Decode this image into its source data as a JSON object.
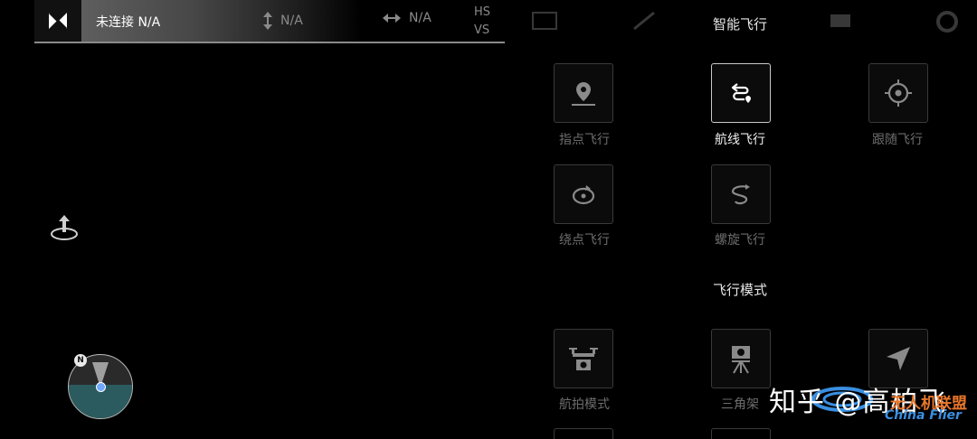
{
  "status_bar": {
    "connection": "未连接 N/A",
    "altitude": "N/A",
    "distance": "N/A",
    "hs": "HS",
    "vs": "VS"
  },
  "compass": {
    "north": "N"
  },
  "smart_flight": {
    "title": "智能飞行",
    "items": [
      {
        "label": "指点飞行",
        "icon": "map-pin-icon",
        "active": false
      },
      {
        "label": "航线飞行",
        "icon": "route-icon",
        "active": true
      },
      {
        "label": "跟随飞行",
        "icon": "crosshair-icon",
        "active": false
      },
      {
        "label": "绕点飞行",
        "icon": "orbit-icon",
        "active": false
      },
      {
        "label": "螺旋飞行",
        "icon": "spiral-icon",
        "active": false
      }
    ]
  },
  "flight_mode": {
    "title": "飞行模式",
    "items": [
      {
        "label": "航拍模式",
        "icon": "aerial-drone-icon"
      },
      {
        "label": "三角架",
        "icon": "tripod-icon"
      },
      {
        "label": "",
        "icon": "navigation-arrow-icon"
      }
    ]
  },
  "watermark": {
    "text": "知乎 @高柏飞",
    "brand_cn": "无人机联盟",
    "brand_en": "China Flier"
  },
  "colors": {
    "background": "#000000",
    "active_label": "#efefef",
    "inactive_label": "#6d6d6d",
    "compass_ground": "#2b5b5e",
    "watermark_orange": "#e8762a",
    "watermark_blue": "#3a8fe0"
  }
}
